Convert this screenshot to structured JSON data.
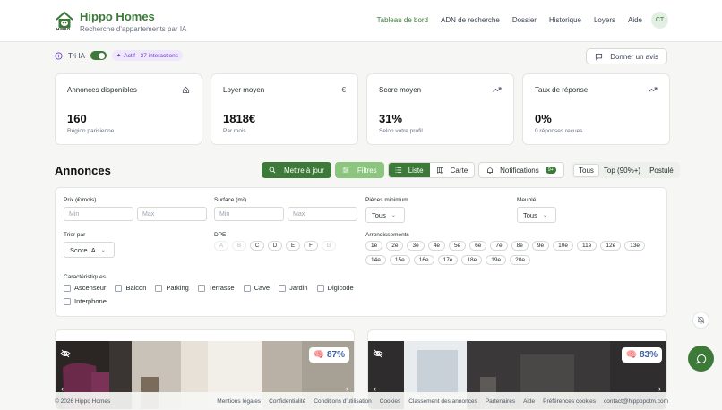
{
  "header": {
    "brand_title": "Hippo Homes",
    "brand_subtitle": "Recherche d'appartements par IA",
    "logo_text": "HIPPO",
    "nav": [
      {
        "label": "Tableau de bord",
        "active": true
      },
      {
        "label": "ADN de recherche",
        "active": false
      },
      {
        "label": "Dossier",
        "active": false
      },
      {
        "label": "Historique",
        "active": false
      },
      {
        "label": "Loyers",
        "active": false
      },
      {
        "label": "Aide",
        "active": false
      }
    ],
    "avatar_initials": "CT"
  },
  "ai_bar": {
    "label": "Tri IA",
    "toggle_on": true,
    "badge": "Actif · 37 interactions",
    "feedback_button": "Donner un avis"
  },
  "stats": [
    {
      "label": "Annonces disponibles",
      "icon": "home-icon",
      "value": "160",
      "sub": "Région parisienne"
    },
    {
      "label": "Loyer moyen",
      "icon": "euro-icon",
      "value": "1818€",
      "sub": "Par mois"
    },
    {
      "label": "Score moyen",
      "icon": "trend-icon",
      "value": "31%",
      "sub": "Selon votre profil"
    },
    {
      "label": "Taux de réponse",
      "icon": "trend-icon",
      "value": "0%",
      "sub": "0 réponses reçues"
    }
  ],
  "listings": {
    "title": "Annonces",
    "update_button": "Mettre à jour",
    "filters_button": "Filtres",
    "view_list": "Liste",
    "view_map": "Carte",
    "notifications_label": "Notifications",
    "notifications_count": "9+",
    "segments": [
      {
        "label": "Tous",
        "active": true
      },
      {
        "label": "Top (90%+)",
        "active": false
      },
      {
        "label": "Postulé",
        "active": false
      }
    ]
  },
  "filters": {
    "price_label": "Prix (€/mois)",
    "price_min_placeholder": "Min",
    "price_max_placeholder": "Max",
    "surface_label": "Surface (m²)",
    "surface_min_placeholder": "Min",
    "surface_max_placeholder": "Max",
    "rooms_label": "Pièces minimum",
    "rooms_value": "Tous",
    "furnished_label": "Meublé",
    "furnished_value": "Tous",
    "sort_label": "Trier par",
    "sort_value": "Score IA",
    "dpe_label": "DPE",
    "dpe": [
      {
        "label": "A",
        "enabled": false
      },
      {
        "label": "B",
        "enabled": false
      },
      {
        "label": "C",
        "enabled": true
      },
      {
        "label": "D",
        "enabled": true
      },
      {
        "label": "E",
        "enabled": true
      },
      {
        "label": "F",
        "enabled": true
      },
      {
        "label": "G",
        "enabled": false
      }
    ],
    "arr_label": "Arrondissements",
    "arrondissements": [
      "1e",
      "2e",
      "3e",
      "4e",
      "5e",
      "6e",
      "7e",
      "8e",
      "9e",
      "10e",
      "11e",
      "12e",
      "13e",
      "14e",
      "15e",
      "16e",
      "17e",
      "18e",
      "19e",
      "20e"
    ],
    "features_label": "Caractéristiques",
    "features": [
      "Ascenseur",
      "Balcon",
      "Parking",
      "Terrasse",
      "Cave",
      "Jardin",
      "Digicode",
      "Interphone"
    ]
  },
  "cards": [
    {
      "score": "87%"
    },
    {
      "score": "83%"
    }
  ],
  "footer": {
    "copyright": "© 2026 Hippo Homes",
    "links": [
      "Mentions légales",
      "Confidentialité",
      "Conditions d'utilisation",
      "Cookies",
      "Classement des annonces",
      "Partenaires",
      "Aide",
      "Préférences cookies",
      "contact@hippopotm.com"
    ]
  },
  "colors": {
    "brand_green": "#3d7a3a",
    "light_green": "#8bc57e",
    "ai_purple": "#6d3fc2",
    "score_blue": "#3b5fa0"
  }
}
